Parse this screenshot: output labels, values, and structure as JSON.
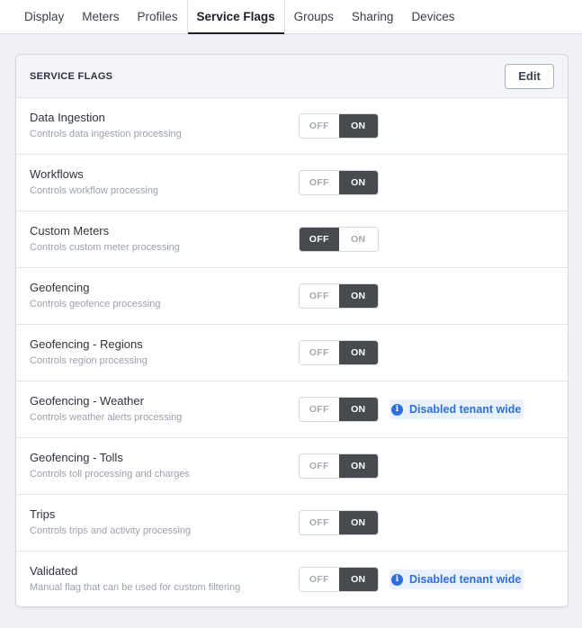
{
  "tabs": [
    "Display",
    "Meters",
    "Profiles",
    "Service Flags",
    "Groups",
    "Sharing",
    "Devices"
  ],
  "active_tab": "Service Flags",
  "card": {
    "title": "SERVICE FLAGS",
    "edit_label": "Edit"
  },
  "toggle_labels": {
    "off": "OFF",
    "on": "ON"
  },
  "flags": [
    {
      "name": "Data Ingestion",
      "description": "Controls data ingestion processing",
      "state": "on",
      "notice": ""
    },
    {
      "name": "Workflows",
      "description": "Controls workflow processing",
      "state": "on",
      "notice": ""
    },
    {
      "name": "Custom Meters",
      "description": "Controls custom meter processing",
      "state": "off",
      "notice": ""
    },
    {
      "name": "Geofencing",
      "description": "Controls geofence processing",
      "state": "on",
      "notice": ""
    },
    {
      "name": "Geofencing - Regions",
      "description": "Controls region processing",
      "state": "on",
      "notice": ""
    },
    {
      "name": "Geofencing - Weather",
      "description": "Controls weather alerts processing",
      "state": "on",
      "notice": "Disabled tenant wide"
    },
    {
      "name": "Geofencing - Tolls",
      "description": "Controls toll processing and charges",
      "state": "on",
      "notice": ""
    },
    {
      "name": "Trips",
      "description": "Controls trips and activity processing",
      "state": "on",
      "notice": ""
    },
    {
      "name": "Validated",
      "description": "Manual flag that can be used for custom filtering",
      "state": "on",
      "notice": "Disabled tenant wide"
    }
  ],
  "icons": {
    "notice": "info-icon"
  },
  "colors": {
    "toggle_selected": "#474a4f",
    "notice_text": "#2f6fdb",
    "notice_bg": "#e9f1fc"
  }
}
